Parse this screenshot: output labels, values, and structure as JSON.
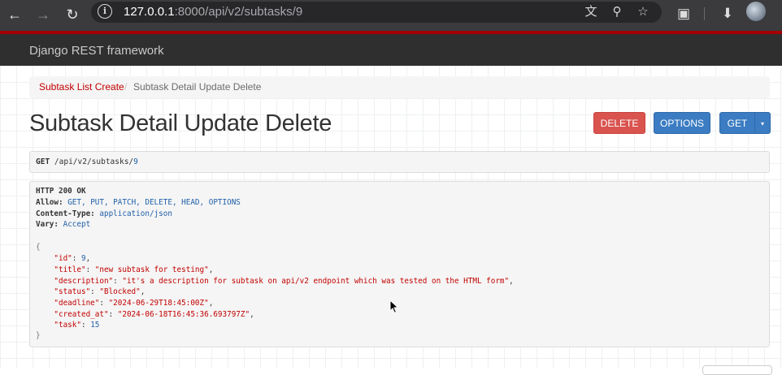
{
  "browser": {
    "url_host": "127.0.0.1",
    "url_rest": ":8000/api/v2/subtasks/9",
    "icons": [
      "back-icon",
      "forward-icon",
      "reload-icon",
      "site-info-icon",
      "translate-icon",
      "zoom-icon",
      "bookmark-star-icon",
      "extensions-icon",
      "download-icon",
      "profile-avatar"
    ]
  },
  "navbar": {
    "brand": "Django REST framework"
  },
  "breadcrumb": {
    "link": "Subtask List Create",
    "separator": "/",
    "current": "Subtask Detail Update Delete"
  },
  "page": {
    "title": "Subtask Detail Update Delete"
  },
  "buttons": {
    "delete": "DELETE",
    "options": "OPTIONS",
    "get": "GET",
    "caret": "▾"
  },
  "request": {
    "method": "GET",
    "path": "/api/v2/subtasks/",
    "id": "9"
  },
  "response": {
    "status": "HTTP 200 OK",
    "allow_key": "Allow:",
    "allow_value": "GET, PUT, PATCH, DELETE, HEAD, OPTIONS",
    "content_type_key": "Content-Type:",
    "content_type_value": "application/json",
    "vary_key": "Vary:",
    "vary_value": "Accept",
    "open_brace": "{",
    "close_brace": "}",
    "fields": [
      {
        "key": "\"id\"",
        "value": "9",
        "kind": "number"
      },
      {
        "key": "\"title\"",
        "value": "\"new subtask for testing\"",
        "kind": "string"
      },
      {
        "key": "\"description\"",
        "value": "\"it's a description for subtask on api/v2 endpoint which was tested on the HTML form\"",
        "kind": "string"
      },
      {
        "key": "\"status\"",
        "value": "\"Blocked\"",
        "kind": "string"
      },
      {
        "key": "\"deadline\"",
        "value": "\"2024-06-29T18:45:00Z\"",
        "kind": "string"
      },
      {
        "key": "\"created_at\"",
        "value": "\"2024-06-18T16:45:36.693797Z\"",
        "kind": "string"
      },
      {
        "key": "\"task\"",
        "value": "15",
        "kind": "number"
      }
    ]
  },
  "colors": {
    "navbar_bg": "#2f2f2f",
    "navbar_border": "#a30000",
    "delete": "#d9534f",
    "primary": "#3b7cc2",
    "link": "#c20000"
  }
}
